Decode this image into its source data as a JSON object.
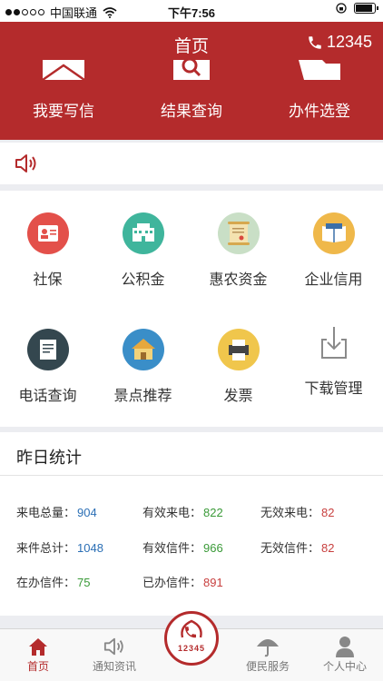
{
  "status_bar": {
    "carrier": "中国联通",
    "time": "下午7:56",
    "battery_level": 0.9
  },
  "header": {
    "title": "首页",
    "phone": "12345",
    "actions": [
      {
        "label": "我要写信",
        "icon": "envelope-icon"
      },
      {
        "label": "结果查询",
        "icon": "search-icon"
      },
      {
        "label": "办件选登",
        "icon": "folder-icon"
      }
    ]
  },
  "notice": {
    "icon": "speaker-icon"
  },
  "services": [
    {
      "label": "社保",
      "icon": "id-card-icon",
      "color": "#e3504a"
    },
    {
      "label": "公积金",
      "icon": "building-icon",
      "color": "#3fb59c"
    },
    {
      "label": "惠农资金",
      "icon": "scroll-icon",
      "color": "#c9dfc6"
    },
    {
      "label": "企业信用",
      "icon": "book-icon",
      "color": "#efb84a"
    },
    {
      "label": "电话查询",
      "icon": "document-icon",
      "color": "#34474f"
    },
    {
      "label": "景点推荐",
      "icon": "house-icon",
      "color": "#3a8ec8"
    },
    {
      "label": "发票",
      "icon": "printer-icon",
      "color": "#f0c64c"
    },
    {
      "label": "下载管理",
      "icon": "download-icon",
      "color": "#8a8a8a"
    }
  ],
  "stats": {
    "title": "昨日统计",
    "items": [
      {
        "label": "来电总量：",
        "value": "904"
      },
      {
        "label": "有效来电：",
        "value": "822"
      },
      {
        "label": "无效来电：",
        "value": "82"
      },
      {
        "label": "来件总计：",
        "value": "1048"
      },
      {
        "label": "有效信件：",
        "value": "966"
      },
      {
        "label": "无效信件：",
        "value": "82"
      },
      {
        "label": "在办信件：",
        "value": "75"
      },
      {
        "label": "已办信件：",
        "value": "891"
      }
    ]
  },
  "tabbar": {
    "tabs": [
      {
        "label": "首页",
        "icon": "home-icon"
      },
      {
        "label": "通知资讯",
        "icon": "speaker-icon"
      },
      {
        "label": "便民服务",
        "icon": "umbrella-icon"
      },
      {
        "label": "个人中心",
        "icon": "person-icon"
      }
    ],
    "hotline": "12345"
  },
  "colors": {
    "brand": "#b42b2c",
    "blue": "#2b6fb5",
    "green": "#3a9a38",
    "red": "#c8403f"
  }
}
